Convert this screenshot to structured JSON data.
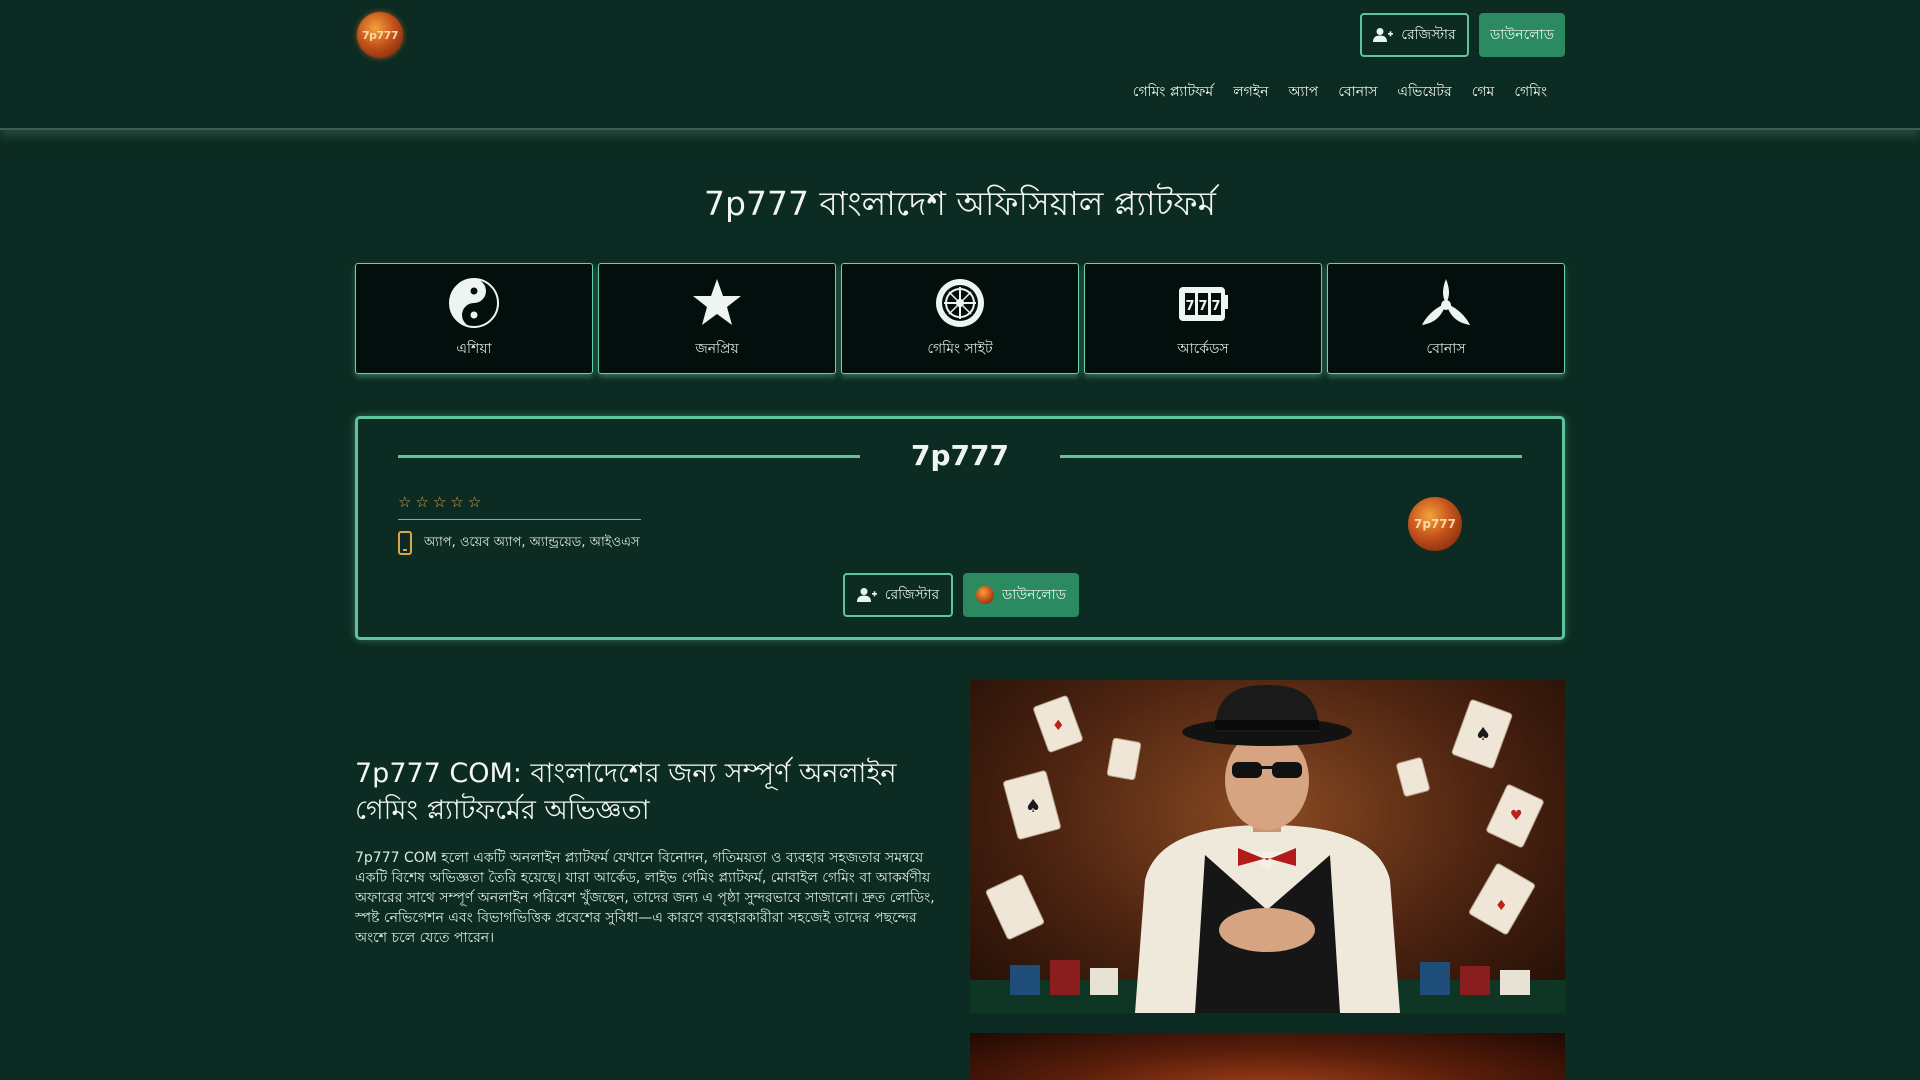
{
  "header": {
    "logo_text": "7p777",
    "register_label": "রেজিস্টার",
    "download_label": "ডাউনলোড",
    "nav": [
      "গেমিং প্ল্যাটফর্ম",
      "লগইন",
      "অ্যাপ",
      "বোনাস",
      "এভিয়েটর",
      "গেম",
      "গেমিং"
    ]
  },
  "main_title": "7p777 বাংলাদেশ অফিসিয়াল প্ল্যাটফর্ম",
  "categories": [
    {
      "label": "এশিয়া",
      "icon": "yin-yang-icon"
    },
    {
      "label": "জনপ্রিয়",
      "icon": "star-icon"
    },
    {
      "label": "গেমিং সাইট",
      "icon": "roulette-icon"
    },
    {
      "label": "আর্কেডস",
      "icon": "slot-machine-icon"
    },
    {
      "label": "বোনাস",
      "icon": "propeller-icon"
    }
  ],
  "info": {
    "title": "7p777",
    "stars": [
      "☆",
      "☆",
      "☆",
      "☆",
      "☆"
    ],
    "platforms": "অ্যাপ, ওয়েব অ্যাপ, অ্যান্ড্রয়েড, আইওএস",
    "logo_text": "7p777",
    "register_label": "রেজিস্টার",
    "download_label": "ডাউনলোড"
  },
  "article": {
    "title": "7p777 COM: বাংলাদেশের জন্য সম্পূর্ণ অনলাইন গেমিং প্ল্যাটফর্মের অভিজ্ঞতা",
    "body": "7p777 COM হলো একটি অনলাইন প্ল্যাটফর্ম যেখানে বিনোদন, গতিময়তা ও ব্যবহার সহজতার সমন্বয়ে একটি বিশেষ অভিজ্ঞতা তৈরি হয়েছে। যারা আর্কেড, লাইভ গেমিং প্ল্যাটফর্ম, মোবাইল গেমিং বা আকর্ষণীয় অফারের সাথে সম্পূর্ণ অনলাইন পরিবেশ খুঁজছেন, তাদের জন্য এ পৃষ্ঠা সুন্দরভাবে সাজানো। দ্রুত লোডিং, স্পষ্ট নেভিগেশন এবং বিভাগভিত্তিক প্রবেশের সুবিধা—এ কারণে ব্যবহারকারীরা সহজেই তাদের পছন্দের অংশে চলে যেতে পারেন।"
  },
  "colors": {
    "background": "#0c2b22",
    "accent": "#5fc49c",
    "button_solid": "#2b8a60",
    "card_bg": "#030f0c",
    "star": "#d9a54a"
  }
}
